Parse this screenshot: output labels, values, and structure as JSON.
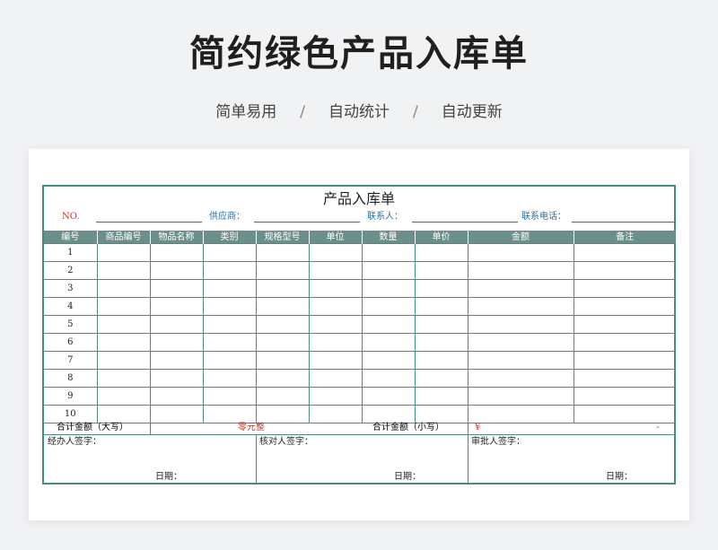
{
  "hero": {
    "title": "简约绿色产品入库单",
    "tags": [
      "简单易用",
      "自动统计",
      "自动更新"
    ],
    "separator": "/"
  },
  "sheet": {
    "title": "产品入库单",
    "no_label": "NO.",
    "supplier_label": "供应商：",
    "contact_label": "联系人：",
    "phone_label": "联系电话：",
    "columns": [
      "编号",
      "商品编号",
      "物品名称",
      "类别",
      "规格型号",
      "单位",
      "数量",
      "单价",
      "金额",
      "备注"
    ],
    "rows": [
      "1",
      "2",
      "3",
      "4",
      "5",
      "6",
      "7",
      "8",
      "9",
      "10"
    ],
    "total_upper_label": "合计金额（大写）",
    "total_upper_value": "零元整",
    "total_lower_label": "合计金额（小写）",
    "currency_symbol": "¥",
    "total_lower_value": "-",
    "signers": [
      "经办人签字：",
      "核对人签字：",
      "审批人签字："
    ],
    "date_label": "日期："
  },
  "colors": {
    "border": "#4a8a82",
    "header_bg": "#6b908b",
    "label_blue": "#2d6f9c",
    "accent_red": "#c0392b"
  }
}
